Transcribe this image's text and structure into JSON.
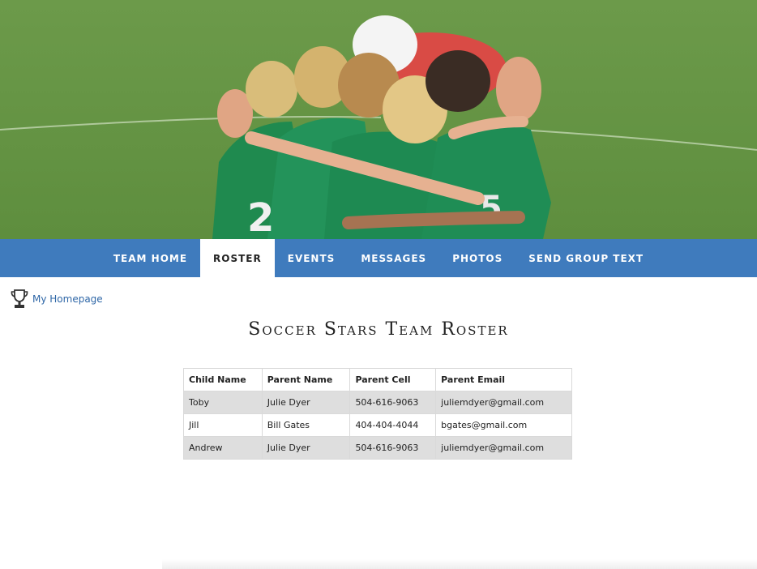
{
  "hero": {
    "icon": "team-huddle-photo"
  },
  "nav": {
    "items": [
      {
        "label": "TEAM HOME",
        "active": false
      },
      {
        "label": "ROSTER",
        "active": true
      },
      {
        "label": "EVENTS",
        "active": false
      },
      {
        "label": "MESSAGES",
        "active": false
      },
      {
        "label": "PHOTOS",
        "active": false
      },
      {
        "label": "SEND GROUP TEXT",
        "active": false
      }
    ],
    "color": "#3f7bbd"
  },
  "home_link": {
    "label": "My Homepage",
    "icon": "trophy-icon"
  },
  "page": {
    "title": "Soccer Stars Team Roster"
  },
  "roster": {
    "headers": [
      "Child Name",
      "Parent Name",
      "Parent Cell",
      "Parent Email"
    ],
    "rows": [
      [
        "Toby",
        "Julie Dyer",
        "504-616-9063",
        "juliemdyer@gmail.com"
      ],
      [
        "Jill",
        "Bill Gates",
        "404-404-4044",
        "bgates@gmail.com"
      ],
      [
        "Andrew",
        "Julie Dyer",
        "504-616-9063",
        "juliemdyer@gmail.com"
      ]
    ]
  }
}
